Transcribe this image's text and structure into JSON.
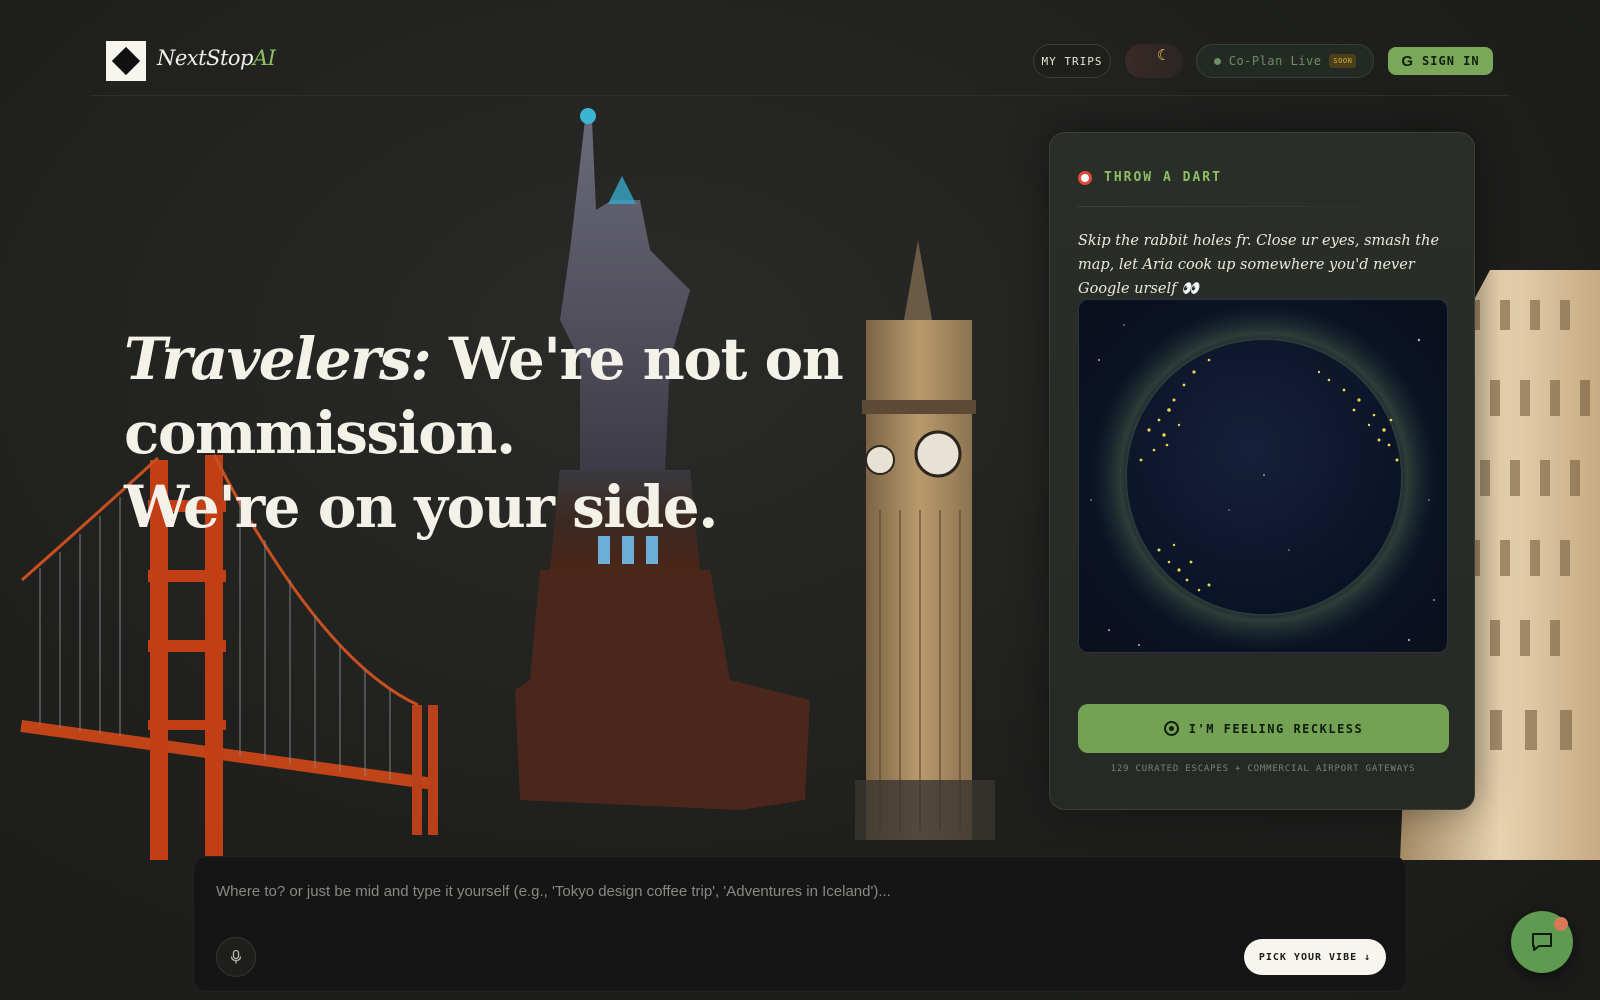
{
  "brand": {
    "name": "NextStop",
    "suffix": "AI"
  },
  "header": {
    "my_trips": "MY TRIPS",
    "coplan_label": "Co-Plan Live",
    "coplan_badge": "SOON",
    "sign_in": "SIGN IN",
    "sign_in_icon": "google-icon",
    "theme_icon": "moon-icon"
  },
  "hero": {
    "title_em": "Travelers:",
    "title_rest": " We're not on commission.",
    "title_line2": "We're on your side."
  },
  "dart": {
    "heading": "THROW A DART",
    "description": "Skip the rabbit holes fr. Close ur eyes, smash the map, let Aria cook up somewhere you'd never Google urself 👀",
    "button": "I'M FEELING RECKLESS",
    "footnote": "129 CURATED ESCAPES + COMMERCIAL AIRPORT GATEWAYS"
  },
  "prompt": {
    "placeholder": "Where to? or just be mid and type it yourself (e.g., 'Tokyo design coffee trip', 'Adventures in Iceland')...",
    "vibe_button": "PICK YOUR VIBE ↓",
    "mic_icon": "microphone-icon"
  },
  "chat": {
    "icon": "chat-bubble-icon"
  },
  "colors": {
    "accent_green": "#7ba75a",
    "background": "#1f201e",
    "card": "#2a2e28",
    "globe_dots": "#e8d94a"
  }
}
